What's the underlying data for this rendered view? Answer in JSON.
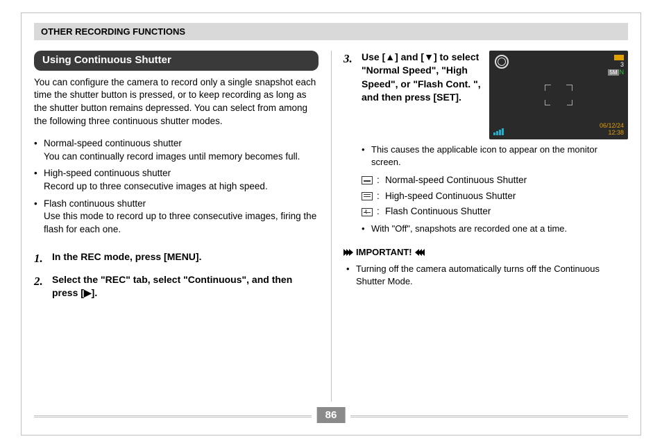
{
  "header": "OTHER RECORDING FUNCTIONS",
  "section_title": "Using Continuous Shutter",
  "intro": "You can configure the camera to record only a single snapshot each time the shutter button is pressed, or to keep recording as long as the shutter button remains depressed. You can select from among the following three continuous shutter modes.",
  "modes_long": [
    {
      "name": "Normal-speed continuous shutter",
      "desc": "You can continually record images until memory becomes full."
    },
    {
      "name": "High-speed continuous shutter",
      "desc": "Record up to three consecutive images at high speed."
    },
    {
      "name": "Flash continuous shutter",
      "desc": "Use this mode to record up to three consecutive images, firing the flash for each one."
    }
  ],
  "steps": {
    "s1": "In the REC mode, press [MENU].",
    "s2": "Select the \"REC\" tab, select \"Continuous\", and then press [▶].",
    "s3": "Use [▲] and [▼] to select \"Normal Speed\", \"High Speed\", or \"Flash Cont. \", and then press [SET].",
    "s3_sub1": "This causes the applicable icon to appear on the monitor screen.",
    "s3_off": "With \"Off\", snapshots are recorded one at a time."
  },
  "mode_labels": {
    "normal": "Normal-speed Continuous Shutter",
    "high": "High-speed Continuous Shutter",
    "flash": "Flash Continuous Shutter"
  },
  "important_label": "IMPORTANT!",
  "important_items": [
    "Turning off the camera automatically turns off the Continuous Shutter Mode."
  ],
  "screen": {
    "shots_remaining": "3",
    "resolution_badge": "5M",
    "quality": "N",
    "date": "06/12/24",
    "time": "12:38"
  },
  "page_number": "86"
}
